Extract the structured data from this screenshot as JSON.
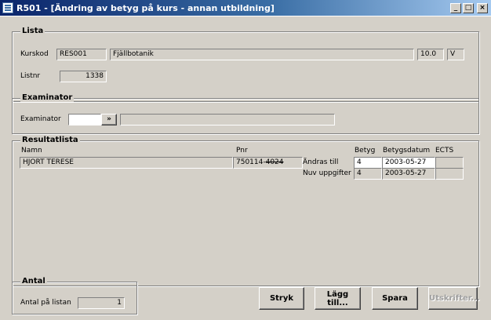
{
  "window": {
    "title": "R501 - [Ändring av betyg på kurs - annan utbildning]",
    "controls": {
      "minimize": "_",
      "maximize": "□",
      "close": "×"
    }
  },
  "lista": {
    "legend": "Lista",
    "kurskod_label": "Kurskod",
    "kurskod_value": "RES001",
    "course_name": "Fjällbotanik",
    "points": "10.0",
    "unit": "V",
    "listnr_label": "Listnr",
    "listnr_value": "1338"
  },
  "examinator": {
    "legend": "Examinator",
    "label": "Examinator",
    "code_value": "",
    "lookup_label": "»",
    "name_value": ""
  },
  "resultatlista": {
    "legend": "Resultatlista",
    "col_namn": "Namn",
    "col_pnr": "Pnr",
    "row_name": "HJORT TERESE",
    "row_pnr_start": "750114-",
    "row_pnr_end": "4024",
    "col_betyg": "Betyg",
    "col_betygsdatum": "Betygsdatum",
    "col_ects": "ECTS",
    "andras_label": "Ändras till",
    "andras_betyg": "4",
    "andras_datum": "2003-05-27",
    "andras_ects": "",
    "nuv_label": "Nuv uppgifter",
    "nuv_betyg": "4",
    "nuv_datum": "2003-05-27",
    "nuv_ects": ""
  },
  "antal": {
    "legend": "Antal",
    "label": "Antal på listan",
    "value": "1"
  },
  "buttons": {
    "stryk": "Stryk",
    "lagg_till": "Lägg till...",
    "spara": "Spara",
    "utskrifter": "Utskrifter..."
  }
}
